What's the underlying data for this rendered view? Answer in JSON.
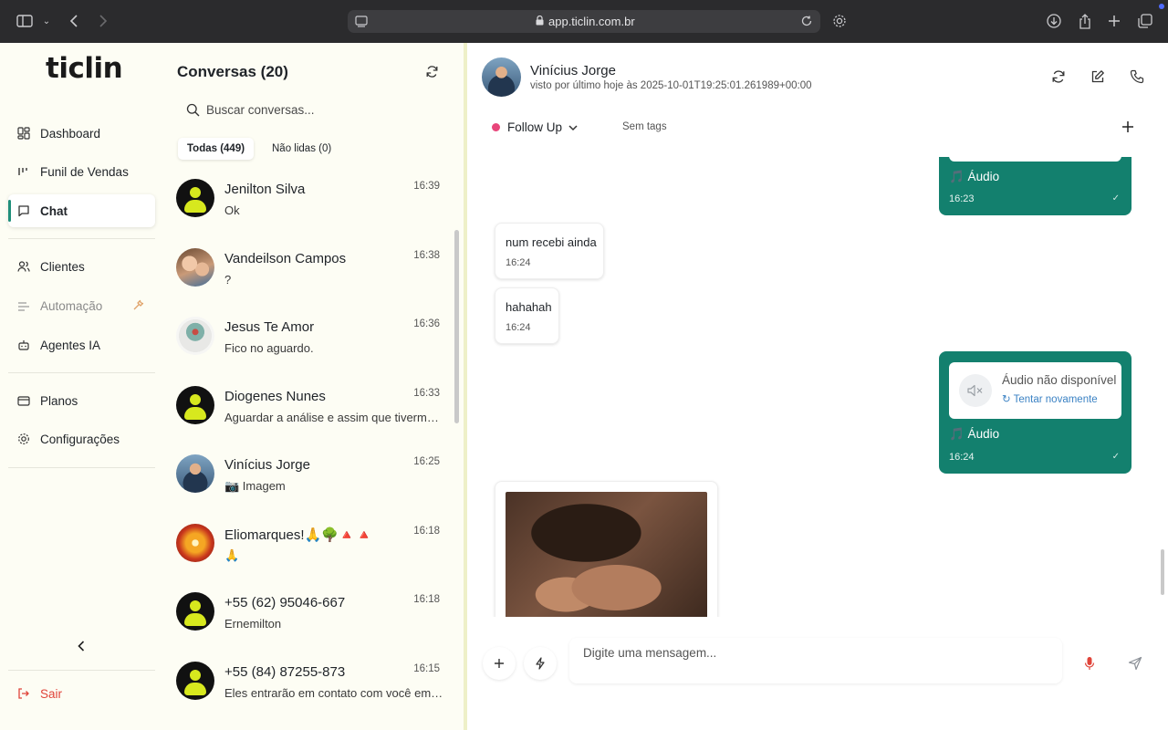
{
  "browser": {
    "url": "app.ticlin.com.br"
  },
  "sidebar": {
    "logo": "ticlin",
    "items": [
      {
        "label": "Dashboard",
        "icon": "dashboard-icon"
      },
      {
        "label": "Funil de Vendas",
        "icon": "funnel-icon"
      },
      {
        "label": "Chat",
        "icon": "chat-icon",
        "active": true
      },
      {
        "label": "Clientes",
        "icon": "users-icon"
      },
      {
        "label": "Automação",
        "icon": "automation-icon",
        "disabled": true
      },
      {
        "label": "Agentes IA",
        "icon": "bot-icon"
      },
      {
        "label": "Planos",
        "icon": "card-icon"
      },
      {
        "label": "Configurações",
        "icon": "gear-icon"
      }
    ],
    "logout": "Sair",
    "accent": "#1f8f7a",
    "logout_color": "#e0443a"
  },
  "conversations": {
    "title": "Conversas (20)",
    "search_placeholder": "Buscar conversas...",
    "filters": [
      "Todas (449)",
      "Não lidas (0)"
    ],
    "items": [
      {
        "name": "Jenilton Silva",
        "message": "Ok",
        "time": "16:39"
      },
      {
        "name": "Vandeilson Campos",
        "message": "?",
        "time": "16:38"
      },
      {
        "name": "Jesus Te Amor",
        "message": "Fico no aguardo.",
        "time": "16:36"
      },
      {
        "name": "Diogenes Nunes",
        "message": "Aguardar a análise e assim que tivermos uma resposta",
        "time": "16:33"
      },
      {
        "name": "Vinícius Jorge",
        "message": "📷 Imagem",
        "time": "16:25"
      },
      {
        "name": "Eliomarques!🙏🌳🔺🔺",
        "message": "🙏",
        "time": "16:18"
      },
      {
        "name": "+55 (62) 95046-667",
        "message": "Ernemilton",
        "time": "16:18"
      },
      {
        "name": "+55 (84) 87255-873",
        "message": "Eles entrarão em contato com você em breve",
        "time": "16:15"
      }
    ]
  },
  "chat": {
    "contact_name": "Vinícius Jorge",
    "last_seen": "visto por último hoje às 2025-10-01T19:25:01.261989+00:00",
    "stage": "Follow Up",
    "stage_color": "#e8457a",
    "tags": "Sem tags",
    "messages": [
      {
        "dir": "out",
        "type": "audio",
        "label": "🎵 Áudio",
        "time": "16:23"
      },
      {
        "dir": "in",
        "text": "num recebi ainda",
        "time": "16:24"
      },
      {
        "dir": "in",
        "text": "hahahah",
        "time": "16:24"
      },
      {
        "dir": "out",
        "type": "audio",
        "unavailable": "Áudio não disponível",
        "retry": "Tentar novamente",
        "label": "🎵 Áudio",
        "time": "16:24"
      },
      {
        "dir": "in",
        "type": "image"
      }
    ],
    "composer_placeholder": "Digite uma mensagem...",
    "bubble_color": "#13806e"
  }
}
